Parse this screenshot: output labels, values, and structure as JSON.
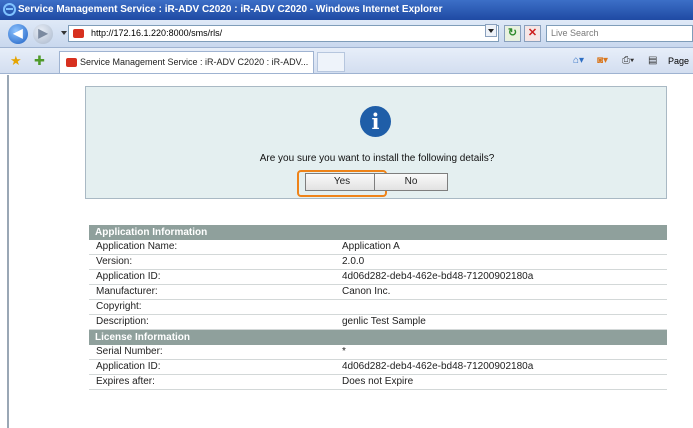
{
  "window": {
    "title": "Service Management Service : iR-ADV C2020 : iR-ADV C2020 - Windows Internet Explorer"
  },
  "browser": {
    "address": "http://172.16.1.220:8000/sms/rls/",
    "search_placeholder": "Live Search",
    "tab_title": "Service Management Service : iR-ADV C2020 : iR-ADV...",
    "command_page_label": "Page"
  },
  "dialog": {
    "question": "Are you sure you want to install the following details?",
    "yes_label": "Yes",
    "no_label": "No"
  },
  "application_info": {
    "heading": "Application Information",
    "rows": [
      {
        "label": "Application Name:",
        "value": "Application A"
      },
      {
        "label": "Version:",
        "value": "2.0.0"
      },
      {
        "label": "Application ID:",
        "value": "4d06d282-deb4-462e-bd48-71200902180a"
      },
      {
        "label": "Manufacturer:",
        "value": "Canon Inc."
      },
      {
        "label": "Copyright:",
        "value": ""
      },
      {
        "label": "Description:",
        "value": "genlic Test Sample"
      }
    ]
  },
  "license_info": {
    "heading": "License Information",
    "rows": [
      {
        "label": "Serial Number:",
        "value": "*"
      },
      {
        "label": "Application ID:",
        "value": "4d06d282-deb4-462e-bd48-71200902180a"
      },
      {
        "label": "Expires after:",
        "value": "Does not Expire"
      }
    ]
  },
  "colors": {
    "highlight": "#ee8319",
    "section_header": "#8fa09c",
    "dialog_bg": "#e4eff0",
    "info_icon": "#1f5ea8"
  }
}
